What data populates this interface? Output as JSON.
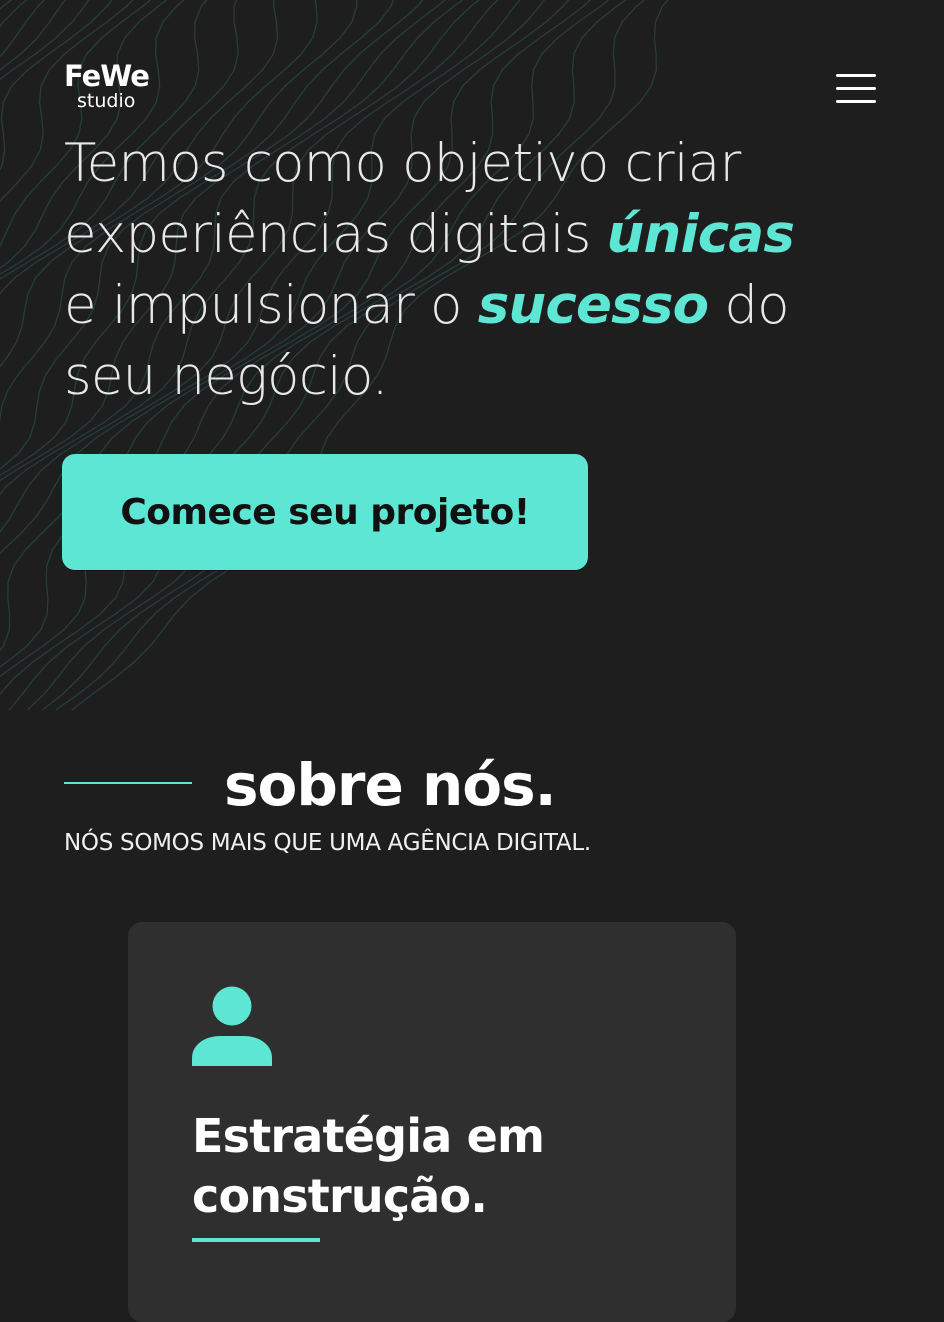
{
  "header": {
    "logo_top": "FeWe",
    "logo_bottom": "studio",
    "menu_icon": "hamburger-menu-icon"
  },
  "hero": {
    "line1": "Temos como objetivo criar",
    "line2_prefix": "experiências digitais",
    "line2_accent": "únicas",
    "line3_prefix": "e impulsionar o",
    "line3_accent": "sucesso",
    "line3_suffix": "do",
    "line4": "seu negócio.",
    "cta_label": "Comece seu projeto!"
  },
  "about": {
    "title": "sobre nós.",
    "subtitle": "NÓS SOMOS MAIS QUE UMA AGÊNCIA DIGITAL."
  },
  "card": {
    "icon": "user-icon",
    "title_line1": "Estratégia em",
    "title_line2": "construção."
  },
  "colors": {
    "background": "#1e1e1e",
    "accent": "#5ee6d5",
    "card": "#2f2f2f",
    "text": "#ffffff"
  }
}
